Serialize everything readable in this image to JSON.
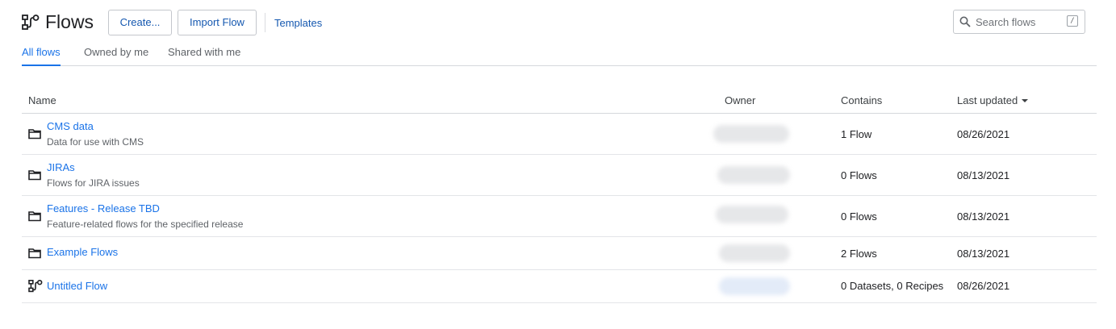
{
  "header": {
    "title": "Flows",
    "create_label": "Create...",
    "import_label": "Import Flow",
    "templates_label": "Templates",
    "search_placeholder": "Search flows",
    "search_value": "",
    "search_shortcut": "/"
  },
  "tabs": [
    {
      "label": "All flows",
      "active": true
    },
    {
      "label": "Owned by me",
      "active": false
    },
    {
      "label": "Shared with me",
      "active": false
    }
  ],
  "table": {
    "columns": [
      "Name",
      "Owner",
      "Contains",
      "Last updated"
    ],
    "sort": {
      "column": "Last updated",
      "direction": "descending"
    },
    "rows": [
      {
        "type": "folder",
        "name": "CMS data",
        "description": "Data for use with CMS",
        "contains": "1 Flow",
        "updated": "08/26/2021"
      },
      {
        "type": "folder",
        "name": "JIRAs",
        "description": "Flows for JIRA issues",
        "contains": "0 Flows",
        "updated": "08/13/2021"
      },
      {
        "type": "folder",
        "name": "Features - Release TBD",
        "description": "Feature-related flows for the specified release",
        "contains": "0 Flows",
        "updated": "08/13/2021"
      },
      {
        "type": "folder",
        "name": "Example Flows",
        "description": "",
        "contains": "2 Flows",
        "updated": "08/13/2021"
      },
      {
        "type": "flow",
        "name": "Untitled Flow",
        "description": "",
        "contains": "0 Datasets, 0 Recipes",
        "updated": "08/26/2021"
      }
    ]
  },
  "colors": {
    "accent": "#1a73e8",
    "text": "#202124",
    "muted": "#5f6368",
    "border": "#d5d8dc"
  }
}
